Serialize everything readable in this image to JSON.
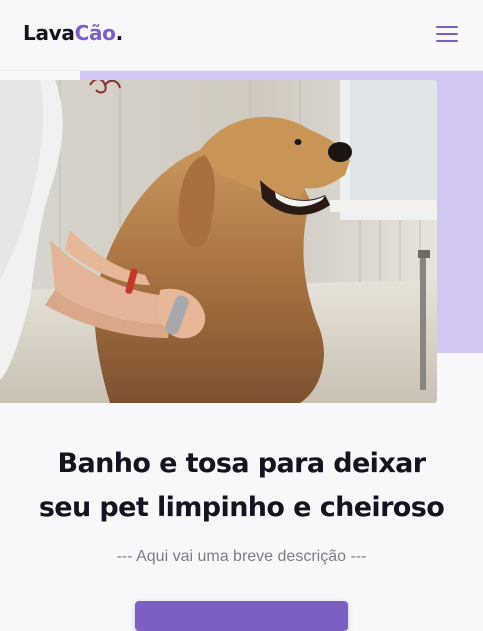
{
  "header": {
    "logo_part1": "Lava",
    "logo_part2": "Cão",
    "logo_dot": ".",
    "menu_icon": "hamburger-menu-icon"
  },
  "hero": {
    "image_icon": "dog-bath-photo",
    "headline_line1": "Banho e tosa para deixar",
    "headline_line2": "seu pet limpinho e cheiroso",
    "description": "--- Aqui vai uma breve descrição ---",
    "cta_label": ""
  },
  "colors": {
    "accent": "#7c5fc2",
    "accent_light": "#d4c6f2",
    "text_dark": "#15131f",
    "text_muted": "#7d7d88",
    "background": "#f8f8fa"
  }
}
